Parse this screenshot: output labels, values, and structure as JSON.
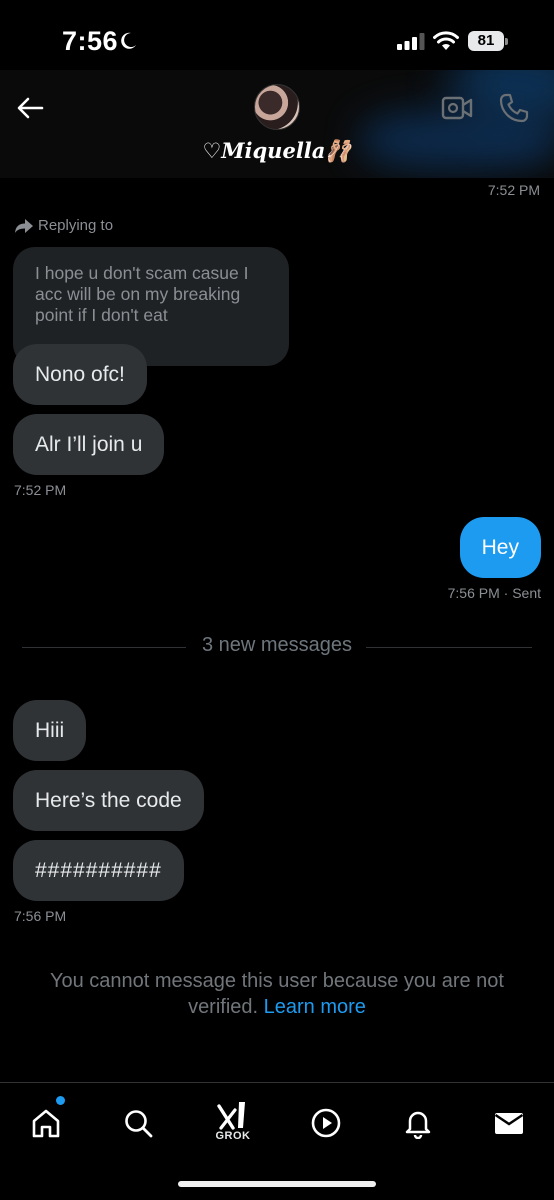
{
  "status_bar": {
    "time": "7:56",
    "battery": "81",
    "moon_icon": "moon-icon",
    "signal_icon": "cellular-signal-icon",
    "wifi_icon": "wifi-icon"
  },
  "header": {
    "contact_name": "♡Miquella🩰",
    "back_icon": "arrow-left-icon",
    "video_icon": "video-call-icon",
    "call_icon": "phone-icon"
  },
  "messages": {
    "top_timestamp": "7:52 PM",
    "replying_to_label": "Replying to",
    "quoted_text": "I hope u don't scam casue I acc will be on my breaking point if I don't eat",
    "received_1": "Nono ofc!",
    "received_2": "Alr I’ll join u",
    "received_timestamp_1": "7:52 PM",
    "sent_1": "Hey",
    "sent_timestamp": "7:56 PM · Sent",
    "new_messages_divider": "3 new messages",
    "received_3": "Hiii",
    "received_4": "Here’s the code",
    "received_5": "##########",
    "received_timestamp_2": "7:56 PM"
  },
  "notice": {
    "text": "You cannot message this user because you are not verified.",
    "link": "Learn more"
  },
  "tab_bar": {
    "grok_label": "GROK",
    "accent_color": "#1d9bf0",
    "icons": [
      "home-icon",
      "search-icon",
      "grok-icon",
      "video-play-icon",
      "bell-icon",
      "mail-icon"
    ]
  }
}
